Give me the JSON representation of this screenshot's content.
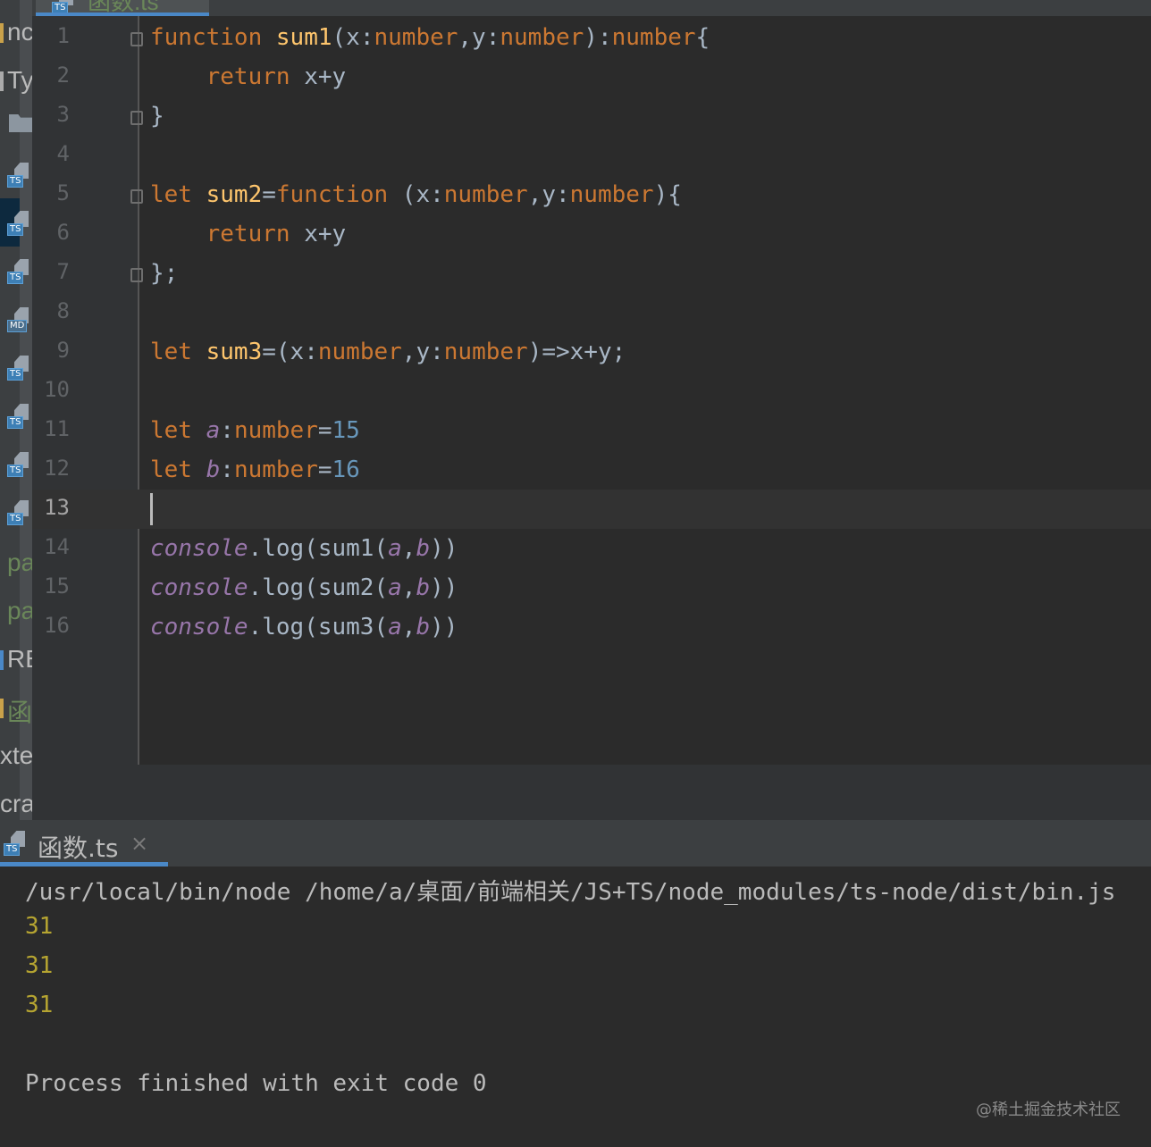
{
  "editor_tab": {
    "label": "函数.ts"
  },
  "sidebar": {
    "labels": [
      "nc",
      "Ty",
      "pa",
      "pa",
      "RE",
      "函",
      "xte",
      "cra"
    ],
    "file_tags": [
      "TS",
      "TS",
      "TS",
      "MD",
      "TS",
      "TS",
      "TS",
      "TS"
    ]
  },
  "editor": {
    "line_numbers": [
      "1",
      "2",
      "3",
      "4",
      "5",
      "6",
      "7",
      "8",
      "9",
      "10",
      "11",
      "12",
      "13",
      "14",
      "15",
      "16"
    ],
    "current_line": "13",
    "lines": [
      "function sum1(x:number,y:number):number{",
      "    return x+y",
      "}",
      "",
      "let sum2=function (x:number,y:number){",
      "    return x+y",
      "};",
      "",
      "let sum3=(x:number,y:number)=>x+y;",
      "",
      "let a:number=15",
      "let b:number=16",
      "",
      "console.log(sum1(a,b))",
      "console.log(sum2(a,b))",
      "console.log(sum3(a,b))"
    ]
  },
  "run_panel": {
    "tab_label": "函数.ts",
    "tab_icon_tag": "TS",
    "close_glyph": "×",
    "command": "/usr/local/bin/node /home/a/桌面/前端相关/JS+TS/node_modules/ts-node/dist/bin.js",
    "outputs": [
      "31",
      "31",
      "31"
    ],
    "exit_message": "Process finished with exit code 0"
  },
  "watermark": "@稀土掘金技术社区",
  "colors": {
    "keyword": "#cc7832",
    "function_name": "#ffc66d",
    "number": "#6897bb",
    "variable": "#9876aa",
    "output": "#b5a431",
    "background": "#2b2b2b"
  }
}
